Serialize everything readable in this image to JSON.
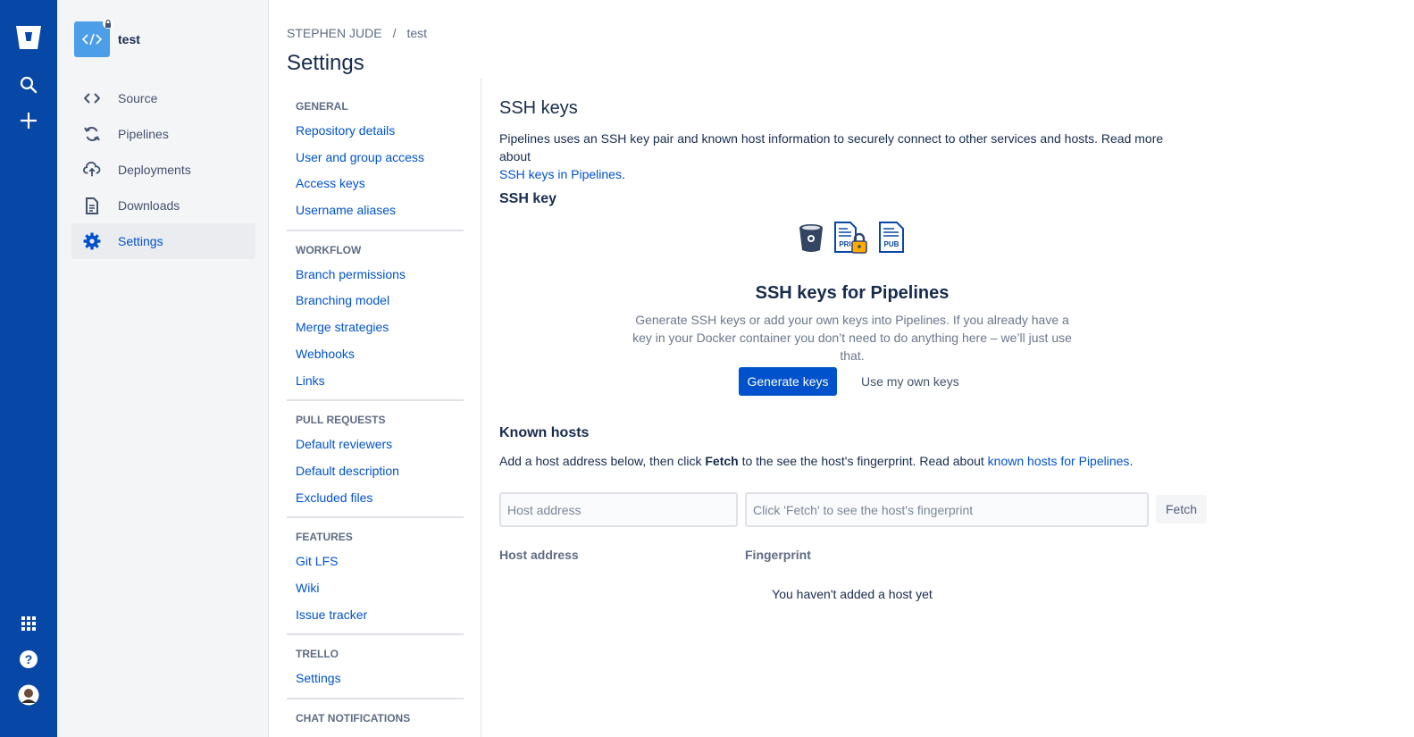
{
  "global_nav": {
    "logo": "bitbucket-logo",
    "top_icons": [
      "search-icon",
      "plus-icon"
    ],
    "bottom_icons": [
      "app-switcher-icon",
      "help-icon",
      "user-avatar"
    ]
  },
  "repo": {
    "name": "test"
  },
  "repo_nav": [
    {
      "label": "Source",
      "icon": "code-icon"
    },
    {
      "label": "Pipelines",
      "icon": "pipelines-icon"
    },
    {
      "label": "Deployments",
      "icon": "deployments-icon"
    },
    {
      "label": "Downloads",
      "icon": "downloads-icon"
    },
    {
      "label": "Settings",
      "icon": "gear-icon",
      "active": true
    }
  ],
  "breadcrumb": {
    "owner": "STEPHEN JUDE",
    "separator": "/",
    "repo": "test"
  },
  "page_title": "Settings",
  "settings_nav": [
    {
      "title": "GENERAL",
      "links": [
        "Repository details",
        "User and group access",
        "Access keys",
        "Username aliases"
      ]
    },
    {
      "title": "WORKFLOW",
      "links": [
        "Branch permissions",
        "Branching model",
        "Merge strategies",
        "Webhooks",
        "Links"
      ]
    },
    {
      "title": "PULL REQUESTS",
      "links": [
        "Default reviewers",
        "Default description",
        "Excluded files"
      ]
    },
    {
      "title": "FEATURES",
      "links": [
        "Git LFS",
        "Wiki",
        "Issue tracker"
      ]
    },
    {
      "title": "TRELLO",
      "links": [
        "Settings"
      ]
    },
    {
      "title": "CHAT NOTIFICATIONS",
      "links": []
    }
  ],
  "main": {
    "heading": "SSH keys",
    "intro_text": "Pipelines uses an SSH key pair and known host information to securely connect to other services and hosts. Read more about",
    "intro_link": "SSH keys in Pipelines",
    "intro_end": ".",
    "ssh_key_heading": "SSH key",
    "key_icons": {
      "private_label": "PRI",
      "public_label": "PUB"
    },
    "pipelines_heading": "SSH keys for Pipelines",
    "pipelines_desc": "Generate SSH keys or add your own keys into Pipelines. If you already have a key in your Docker container you don’t need to do anything here – we’ll just use that.",
    "generate_button": "Generate keys",
    "own_keys_button": "Use my own keys",
    "known_hosts_heading": "Known hosts",
    "known_desc_1": "Add a host address below, then click ",
    "known_desc_bold": "Fetch",
    "known_desc_2": " to the see the host's fingerprint. Read about ",
    "known_desc_link": "known hosts for Pipelines",
    "known_desc_end": ".",
    "host_placeholder": "Host address",
    "fingerprint_placeholder": "Click 'Fetch' to see the host's fingerprint",
    "fetch_button": "Fetch",
    "table_headers": [
      "Host address",
      "Fingerprint"
    ],
    "empty_message": "You haven't added a host yet"
  },
  "colors": {
    "global_nav": "#0747a6",
    "primary": "#0052cc",
    "sidebar": "#f4f5f7"
  }
}
